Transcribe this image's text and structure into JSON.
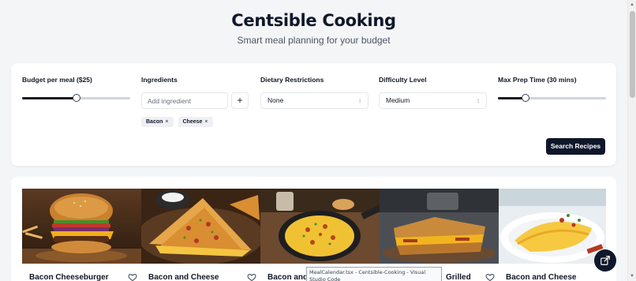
{
  "header": {
    "title": "Centsible Cooking",
    "subtitle": "Smart meal planning for your budget"
  },
  "filters": {
    "budget": {
      "label": "Budget per meal ($25)",
      "value": 25,
      "fraction": 0.5
    },
    "ingredients": {
      "label": "Ingredients",
      "placeholder": "Add ingredient",
      "add_label": "+",
      "tags": [
        {
          "label": "Bacon",
          "remove": "×"
        },
        {
          "label": "Cheese",
          "remove": "×"
        }
      ]
    },
    "dietary": {
      "label": "Dietary Restrictions",
      "value": "None"
    },
    "difficulty": {
      "label": "Difficulty Level",
      "value": "Medium"
    },
    "prep_time": {
      "label": "Max Prep Time (30 mins)",
      "value": 30,
      "fraction": 0.25
    },
    "search_label": "Search Recipes"
  },
  "recipes": [
    {
      "title": "Bacon Cheeseburger",
      "image": "cheeseburger-photo"
    },
    {
      "title": "Bacon and Cheese",
      "image": "quesadilla-photo"
    },
    {
      "title": "Bacon and",
      "image": "skillet-scramble-photo"
    },
    {
      "title": "Grilled",
      "image": "grilled-cheese-photo"
    },
    {
      "title": "Bacon and Cheese",
      "image": "omelette-photo"
    }
  ],
  "tooltip": {
    "text": "MealCalendar.tsx - Centsible-Cooking - Visual Studio Code"
  },
  "icons": {
    "favorite": "heart-icon",
    "fab": "open-external-icon",
    "chevron": "chevron-updown-icon"
  },
  "colors": {
    "primary": "#0f172a",
    "background": "#f4f5f7"
  }
}
